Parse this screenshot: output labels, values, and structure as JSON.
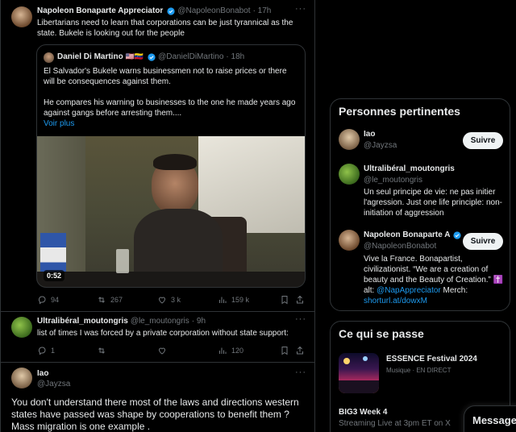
{
  "colors": {
    "accent": "#1d9bf0",
    "bg": "#000000",
    "border": "#2f3336",
    "muted": "#71767b"
  },
  "tweet1": {
    "name": "Napoleon Bonaparte Appreciator",
    "handle": "@NapoleonBonabot",
    "time": "· 17h",
    "text": "Libertarians need to learn that corporations can be just tyrannical as the state. Bukele is looking out for the people",
    "quote": {
      "name": "Daniel Di Martino",
      "flags": "🇺🇸🇻🇪",
      "handle": "@DanielDiMartino",
      "time": "· 18h",
      "text1": "El Salvador's Bukele warns businessmen not to raise prices or there will be consequences against them.",
      "text2": "He compares his warning to businesses to the one he made years ago against gangs before arresting them....",
      "see_more": "Voir plus",
      "video_duration": "0:52"
    },
    "stats": {
      "replies": "94",
      "reposts": "267",
      "likes": "3 k",
      "views": "159 k"
    }
  },
  "tweet2": {
    "name": "Ultralibéral_moutongris",
    "handle": "@le_moutongris",
    "time": "· 9h",
    "text": "list of times I was forced by a private corporation without state support:",
    "stats": {
      "replies": "1",
      "reposts": "",
      "likes": "",
      "views": "120"
    }
  },
  "tweet3": {
    "name": "Iao",
    "handle": "@Jayzsa",
    "text": "You don't understand there most of the laws and directions western states have passed was shape by cooperations to benefit them ? Mass migration is one example ."
  },
  "relevant": {
    "title": "Personnes pertinentes",
    "people": [
      {
        "name": "Iao",
        "handle": "@Jayzsa",
        "button": "Suivre",
        "bio": ""
      },
      {
        "name": "Ultralibéral_moutongris",
        "handle": "@le_moutongris",
        "bio": "Un seul principe de vie: ne pas initier l'agression. Just one life principle: non-initiation of aggression"
      },
      {
        "name": "Napoleon Bonaparte A",
        "handle": "@NapoleonBonabot",
        "button": "Suivre",
        "bio": "Vive la France. Bonapartist, civilizationist. “We are a creation of beauty and the Beauty of Creation.” ✝️ alt:",
        "bio_mention": "@NapAppreciator",
        "bio_tail": " Merch:",
        "bio_link": "shorturl.at/dowxM"
      }
    ]
  },
  "trends": {
    "title": "Ce qui se passe",
    "items": [
      {
        "title": "ESSENCE Festival 2024",
        "meta": "Musique · EN DIRECT"
      },
      {
        "title": "BIG3 Week 4",
        "meta": "Streaming Live at 3pm ET on X"
      }
    ]
  },
  "messages_label": "Message"
}
